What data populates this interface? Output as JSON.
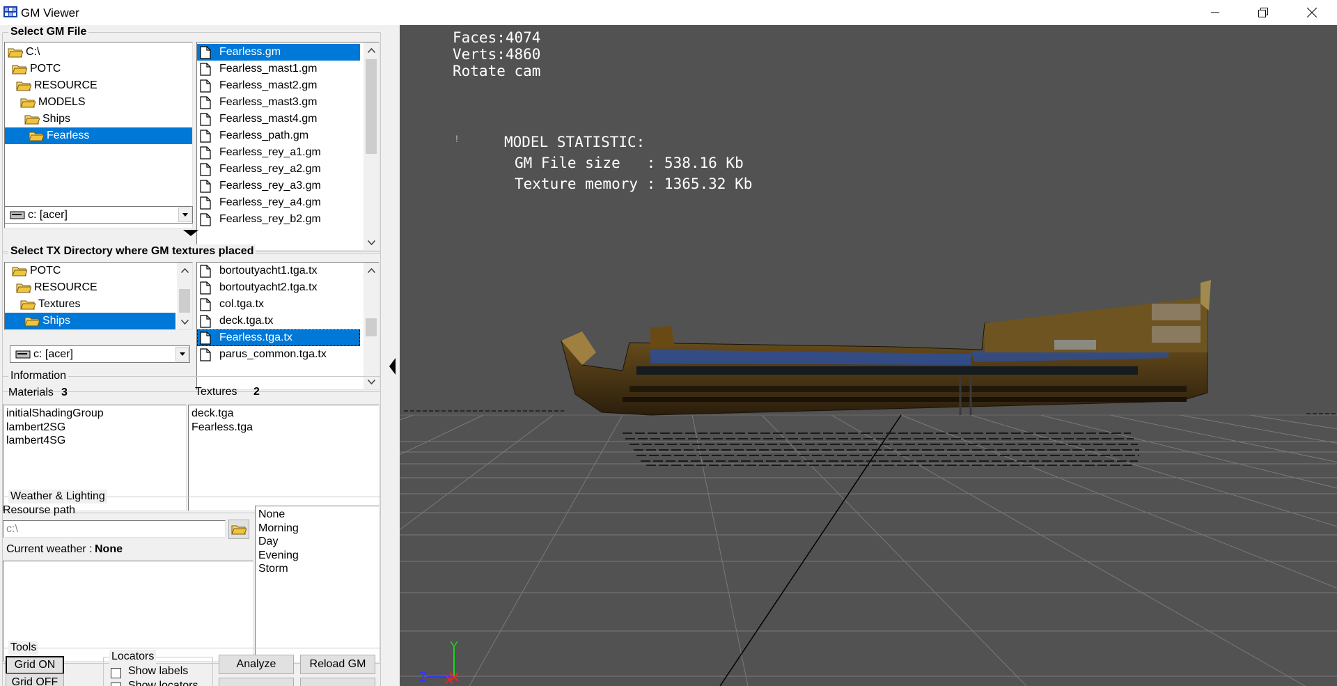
{
  "window": {
    "title": "GM Viewer"
  },
  "gm_file": {
    "title": "Select GM File",
    "folders": [
      {
        "label": "C:\\",
        "selected": false
      },
      {
        "label": "POTC",
        "selected": false
      },
      {
        "label": "RESOURCE",
        "selected": false
      },
      {
        "label": "MODELS",
        "selected": false
      },
      {
        "label": "Ships",
        "selected": false
      },
      {
        "label": "Fearless",
        "selected": true
      }
    ],
    "drive": "c: [acer]",
    "files": [
      {
        "label": "Fearless.gm",
        "selected": true
      },
      {
        "label": "Fearless_mast1.gm",
        "selected": false
      },
      {
        "label": "Fearless_mast2.gm",
        "selected": false
      },
      {
        "label": "Fearless_mast3.gm",
        "selected": false
      },
      {
        "label": "Fearless_mast4.gm",
        "selected": false
      },
      {
        "label": "Fearless_path.gm",
        "selected": false
      },
      {
        "label": "Fearless_rey_a1.gm",
        "selected": false
      },
      {
        "label": "Fearless_rey_a2.gm",
        "selected": false
      },
      {
        "label": "Fearless_rey_a3.gm",
        "selected": false
      },
      {
        "label": "Fearless_rey_a4.gm",
        "selected": false
      },
      {
        "label": "Fearless_rey_b2.gm",
        "selected": false
      }
    ]
  },
  "tx_dir": {
    "title": "Select TX Directory where GM textures placed",
    "folders": [
      {
        "label": "POTC",
        "selected": false
      },
      {
        "label": "RESOURCE",
        "selected": false
      },
      {
        "label": "Textures",
        "selected": false
      },
      {
        "label": "Ships",
        "selected": true
      }
    ],
    "drive": "c: [acer]",
    "files": [
      {
        "label": "bortoutyacht1.tga.tx",
        "selected": false
      },
      {
        "label": "bortoutyacht2.tga.tx",
        "selected": false
      },
      {
        "label": "col.tga.tx",
        "selected": false
      },
      {
        "label": "deck.tga.tx",
        "selected": false
      },
      {
        "label": "Fearless.tga.tx",
        "selected": true
      },
      {
        "label": "parus_common.tga.tx",
        "selected": false
      }
    ]
  },
  "information": {
    "title": "Information",
    "materials_label": "Materials",
    "materials_count": "3",
    "textures_label": "Textures",
    "textures_count": "2",
    "materials": [
      "initialShadingGroup",
      "lambert2SG",
      "lambert4SG"
    ],
    "textures": [
      "deck.tga",
      "Fearless.tga"
    ]
  },
  "weather": {
    "title": "Weather & Lighting",
    "resource_path_label": "Resourse path",
    "resource_path_value": "c:\\",
    "current_weather_label": "Current weather :",
    "current_weather_value": "None",
    "options": [
      "None",
      "Morning",
      "Day",
      "Evening",
      "Storm"
    ]
  },
  "tools": {
    "title": "Tools",
    "grid_on": "Grid ON",
    "grid_off": "Grid OFF",
    "locators_title": "Locators",
    "show_labels": "Show labels",
    "show_locators": "Show locators",
    "analyze": "Analyze",
    "reload_gm": "Reload GM"
  },
  "viewport": {
    "faces": "Faces:4074",
    "verts": "Verts:4860",
    "mode": "Rotate cam",
    "stat_title": "MODEL STATISTIC:",
    "stat_file_size": "GM File size   : 538.16 Kb",
    "stat_texture_memory": "Texture memory : 1365.32 Kb",
    "axis_y": "Y",
    "axis_z": "Z",
    "axis_x": "X"
  },
  "colors": {
    "selection": "#0078d7",
    "viewport_bg": "#525252",
    "folder": "#f0c43c"
  }
}
